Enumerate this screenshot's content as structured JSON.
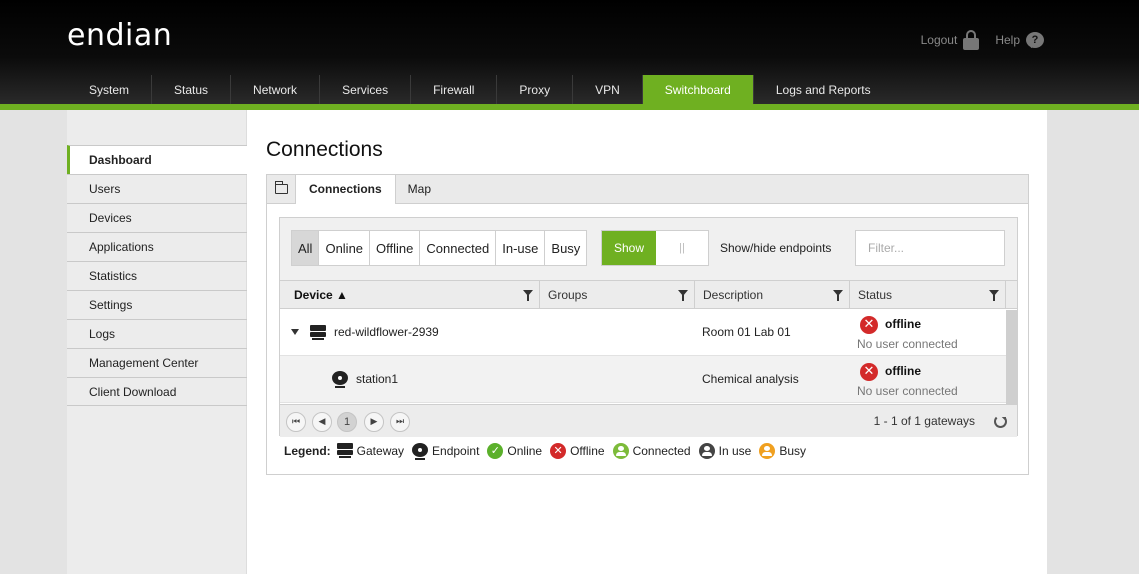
{
  "brand": {
    "logo": "endian"
  },
  "toplinks": {
    "logout": "Logout",
    "help": "Help",
    "help_glyph": "?"
  },
  "nav": {
    "tabs": [
      {
        "label": "System"
      },
      {
        "label": "Status"
      },
      {
        "label": "Network"
      },
      {
        "label": "Services"
      },
      {
        "label": "Firewall"
      },
      {
        "label": "Proxy"
      },
      {
        "label": "VPN"
      },
      {
        "label": "Switchboard"
      },
      {
        "label": "Logs and Reports"
      }
    ],
    "active": "Switchboard"
  },
  "sidebar": {
    "items": [
      {
        "label": "Dashboard"
      },
      {
        "label": "Users"
      },
      {
        "label": "Devices"
      },
      {
        "label": "Applications"
      },
      {
        "label": "Statistics"
      },
      {
        "label": "Settings"
      },
      {
        "label": "Logs"
      },
      {
        "label": "Management Center"
      },
      {
        "label": "Client Download"
      }
    ],
    "active": "Dashboard"
  },
  "page": {
    "title": "Connections"
  },
  "panel_tabs": [
    {
      "label": "Connections"
    },
    {
      "label": "Map"
    }
  ],
  "filters": {
    "buttons": [
      {
        "label": "All"
      },
      {
        "label": "Online"
      },
      {
        "label": "Offline"
      },
      {
        "label": "Connected"
      },
      {
        "label": "In-use"
      },
      {
        "label": "Busy"
      }
    ],
    "active": "All",
    "toggle_label": "Show",
    "toggle_knob": "||",
    "toggle_desc": "Show/hide endpoints",
    "search_placeholder": "Filter..."
  },
  "grid": {
    "columns": [
      {
        "label": "Device ▲"
      },
      {
        "label": "Groups"
      },
      {
        "label": "Description"
      },
      {
        "label": "Status"
      }
    ],
    "rows": [
      {
        "device": "red-wildflower-2939",
        "groups": "",
        "description": "Room 01 Lab 01",
        "status": "offline",
        "status_sub": "No user connected"
      },
      {
        "device": "station1",
        "groups": "",
        "description": "Chemical analysis",
        "status": "offline",
        "status_sub": "No user connected"
      }
    ],
    "x_glyph": "✕"
  },
  "pager": {
    "first": "⏮",
    "prev": "◀",
    "page": "1",
    "next": "▶",
    "last": "⏭",
    "info": "1 - 1 of 1 gateways"
  },
  "legend": {
    "title": "Legend:",
    "items": [
      {
        "label": "Gateway"
      },
      {
        "label": "Endpoint"
      },
      {
        "label": "Online"
      },
      {
        "label": "Offline"
      },
      {
        "label": "Connected"
      },
      {
        "label": "In use"
      },
      {
        "label": "Busy"
      }
    ],
    "check_glyph": "✓",
    "x_glyph": "✕"
  },
  "colors": {
    "accent": "#6fb021",
    "offline": "#d32a2a",
    "online": "#5bb02b",
    "connected": "#7dbb3a",
    "in_use": "#444444",
    "busy": "#f0a020"
  }
}
